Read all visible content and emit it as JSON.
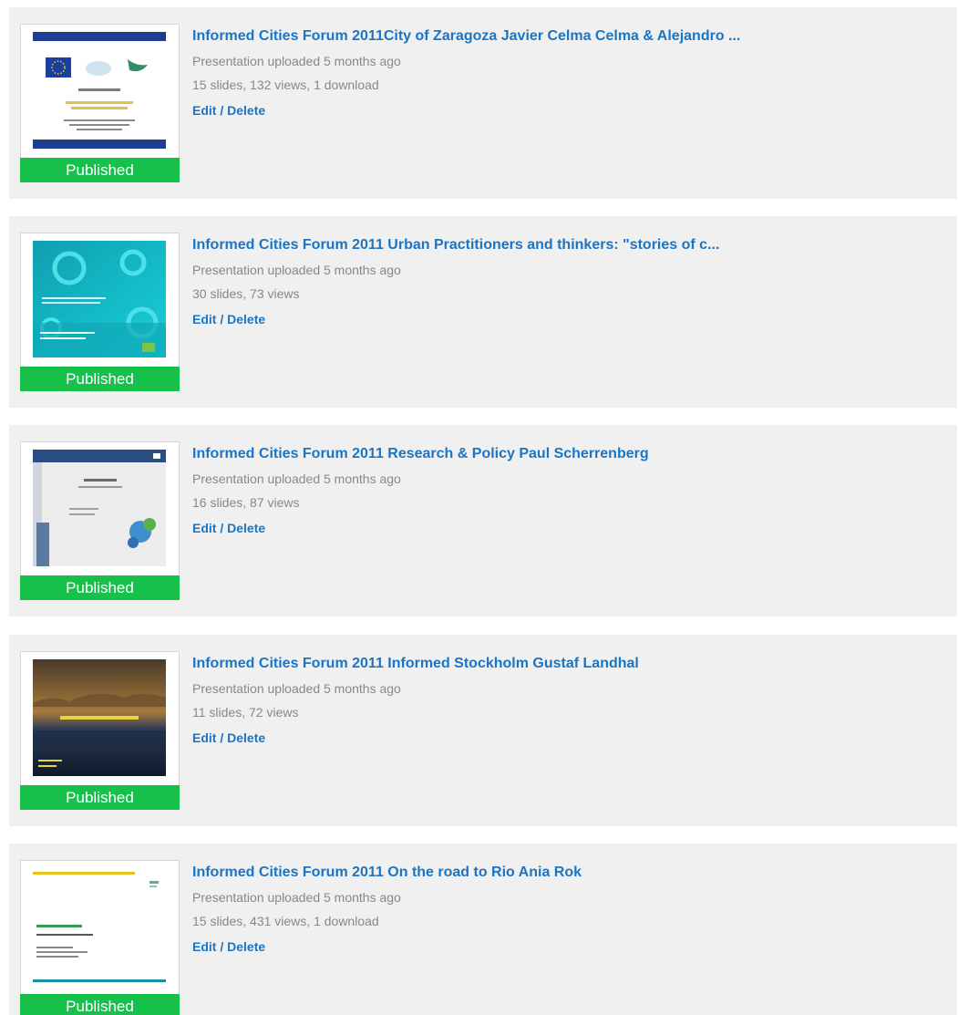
{
  "status_label": "Published",
  "colors": {
    "link": "#1a75c4",
    "published_badge": "#16c04a",
    "card_background": "#f0f0f0",
    "meta_text": "#888888"
  },
  "presentations": [
    {
      "title": "Informed Cities Forum 2011City of Zaragoza Javier Celma Celma & Alejandro ...",
      "uploaded": "Presentation uploaded 5 months ago",
      "stats": "15 slides, 132 views, 1 download",
      "edit_label": "Edit",
      "separator": " / ",
      "delete_label": "Delete"
    },
    {
      "title": "Informed Cities Forum 2011 Urban Practitioners and thinkers: \"stories of c...",
      "uploaded": "Presentation uploaded 5 months ago",
      "stats": "30 slides, 73 views",
      "edit_label": "Edit",
      "separator": " / ",
      "delete_label": "Delete"
    },
    {
      "title": "Informed Cities Forum 2011 Research & Policy Paul Scherrenberg",
      "uploaded": "Presentation uploaded 5 months ago",
      "stats": "16 slides, 87 views",
      "edit_label": "Edit",
      "separator": " / ",
      "delete_label": "Delete"
    },
    {
      "title": "Informed Cities Forum 2011 Informed Stockholm Gustaf Landhal",
      "uploaded": "Presentation uploaded 5 months ago",
      "stats": "11 slides, 72 views",
      "edit_label": "Edit",
      "separator": " / ",
      "delete_label": "Delete"
    },
    {
      "title": "Informed Cities Forum 2011 On the road to Rio Ania Rok",
      "uploaded": "Presentation uploaded 5 months ago",
      "stats": "15 slides, 431 views, 1 download",
      "edit_label": "Edit",
      "separator": " / ",
      "delete_label": "Delete"
    }
  ]
}
